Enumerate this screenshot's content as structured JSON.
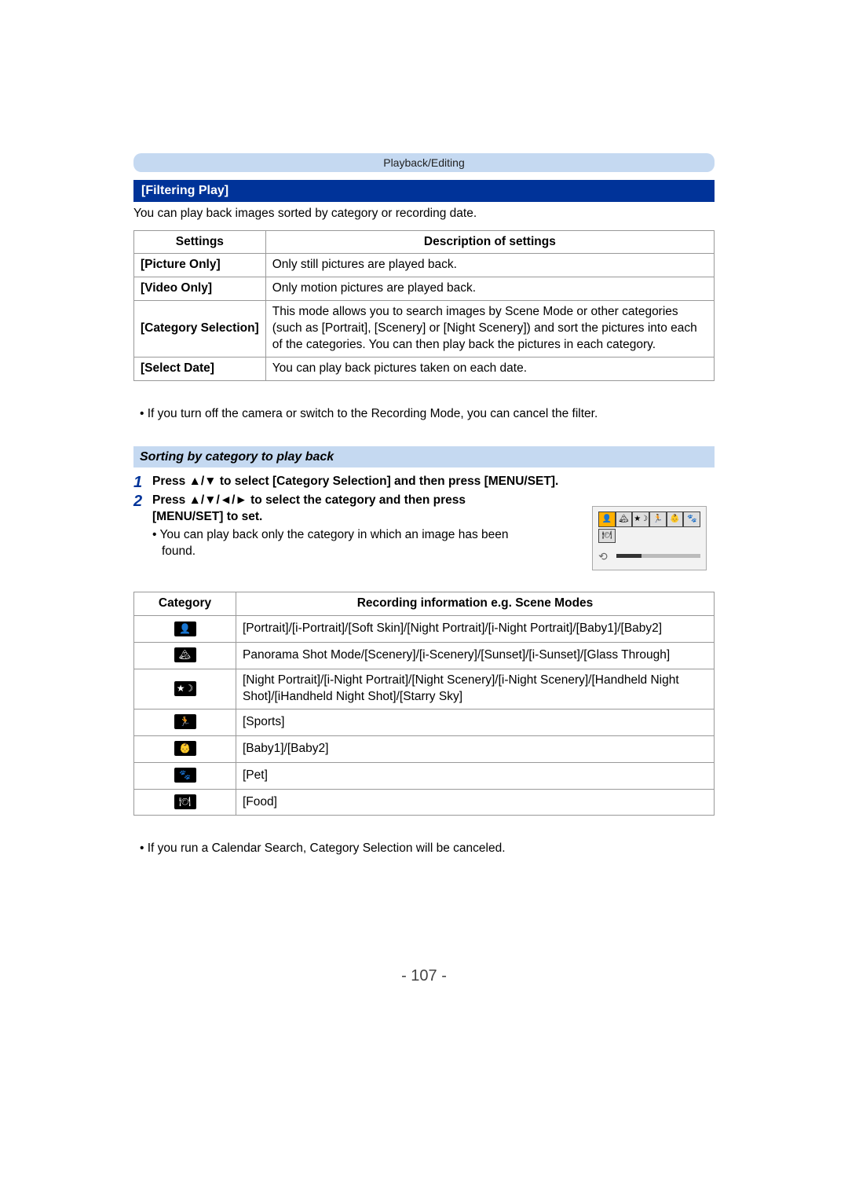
{
  "breadcrumb": "Playback/Editing",
  "section_title": "[Filtering Play]",
  "intro": "You can play back images sorted by category or recording date.",
  "settings_table": {
    "headers": {
      "col1": "Settings",
      "col2": "Description of settings"
    },
    "rows": [
      {
        "s": "[Picture Only]",
        "d": "Only still pictures are played back."
      },
      {
        "s": "[Video Only]",
        "d": "Only motion pictures are played back."
      },
      {
        "s": "[Category Selection]",
        "d": "This mode allows you to search images by Scene Mode or other categories (such as [Portrait], [Scenery] or [Night Scenery]) and sort the pictures into each of the categories. You can then play back the pictures in each category."
      },
      {
        "s": "[Select Date]",
        "d": "You can play back pictures taken on each date."
      }
    ]
  },
  "note1": "• If you turn off the camera or switch to the Recording Mode, you can cancel the filter.",
  "subheader": "Sorting by category to play back",
  "step1_num": "1",
  "step1_text": "Press ▲/▼ to select [Category Selection] and then press [MENU/SET].",
  "step2_num": "2",
  "step2_text_a": "Press ▲/▼/◄/► to select the category and then press [MENU/SET] to set.",
  "step2_note": "• You can play back only the category in which an image has been found.",
  "category_table": {
    "headers": {
      "col1": "Category",
      "col2": "Recording information e.g. Scene Modes"
    },
    "rows": [
      {
        "iconName": "portrait-icon",
        "iconGlyph": "👤",
        "desc": "[Portrait]/[i-Portrait]/[Soft Skin]/[Night Portrait]/[i-Night Portrait]/[Baby1]/[Baby2]"
      },
      {
        "iconName": "scenery-icon",
        "iconGlyph": "🏔",
        "desc": "Panorama Shot Mode/[Scenery]/[i-Scenery]/[Sunset]/[i-Sunset]/[Glass Through]"
      },
      {
        "iconName": "night-icon",
        "iconGlyph": "★☽",
        "desc": "[Night Portrait]/[i-Night Portrait]/[Night Scenery]/[i-Night Scenery]/[Handheld Night Shot]/[iHandheld Night Shot]/[Starry Sky]"
      },
      {
        "iconName": "sports-icon",
        "iconGlyph": "🏃",
        "desc": "[Sports]"
      },
      {
        "iconName": "baby-icon",
        "iconGlyph": "👶",
        "desc": "[Baby1]/[Baby2]"
      },
      {
        "iconName": "pet-icon",
        "iconGlyph": "🐾",
        "desc": "[Pet]"
      },
      {
        "iconName": "food-icon",
        "iconGlyph": "🍽",
        "desc": "[Food]"
      }
    ]
  },
  "note2": "• If you run a Calendar Search, Category Selection will be canceled.",
  "page_number": "- 107 -",
  "figure": {
    "icons": [
      "👤",
      "🏔",
      "★☽",
      "🏃",
      "👶",
      "🐾"
    ],
    "row2": "🍽",
    "dial": "⟲"
  }
}
